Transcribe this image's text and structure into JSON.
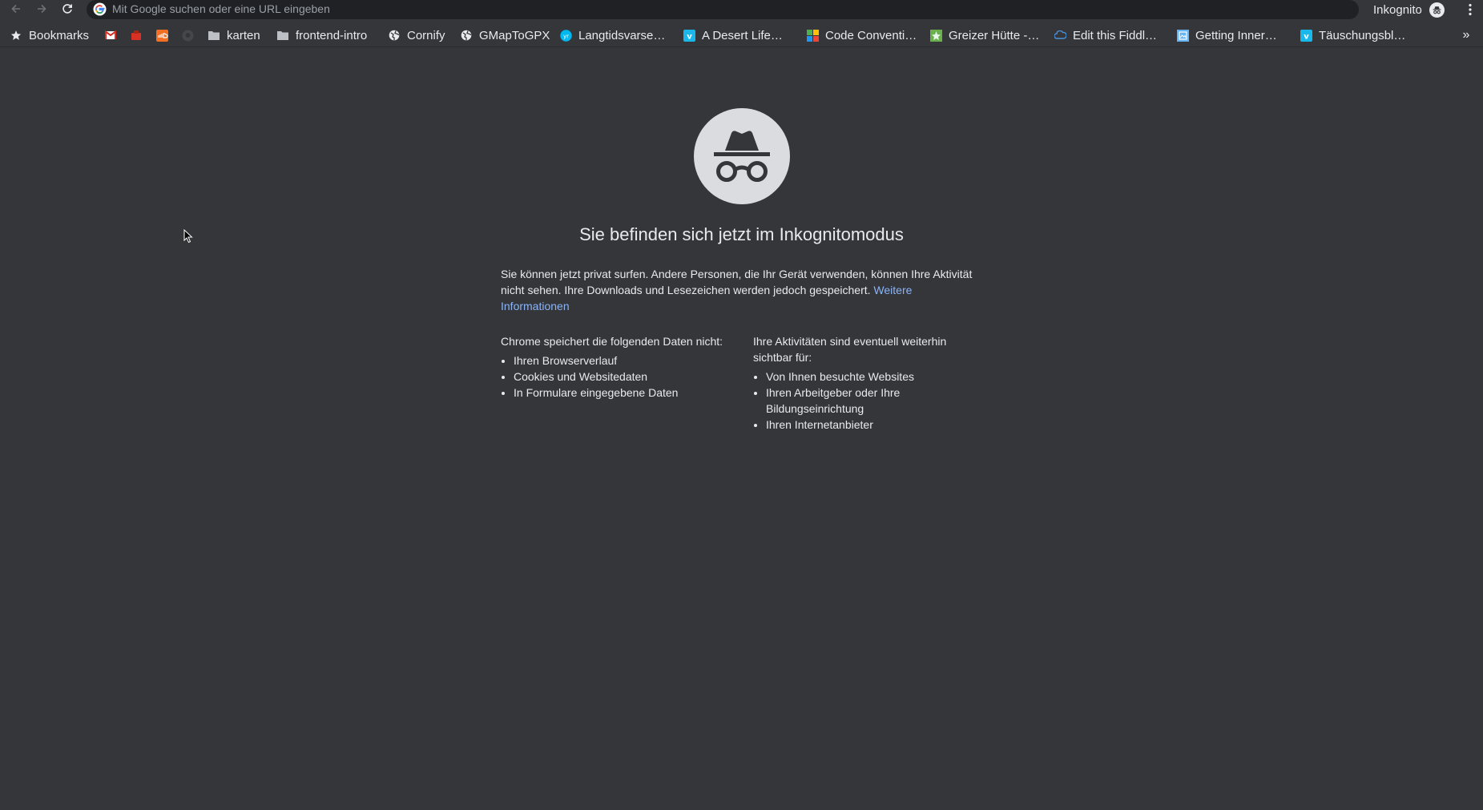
{
  "toolbar": {
    "omnibox_placeholder": "Mit Google suchen oder eine URL eingeben",
    "profile_label": "Inkognito"
  },
  "bookmarks": [
    {
      "label": "Bookmarks",
      "icon": "star-icon"
    },
    {
      "label": "",
      "icon": "gmail-icon"
    },
    {
      "label": "",
      "icon": "red-app-icon"
    },
    {
      "label": "",
      "icon": "soundcloud-icon"
    },
    {
      "label": "",
      "icon": "github-icon"
    },
    {
      "label": "karten",
      "icon": "folder-icon"
    },
    {
      "label": "frontend-intro",
      "icon": "folder-icon"
    },
    {
      "label": "Cornify",
      "icon": "globe-icon"
    },
    {
      "label": "GMapToGPX",
      "icon": "globe-icon"
    },
    {
      "label": "Langtidsvarse…",
      "icon": "yr-icon"
    },
    {
      "label": "A Desert Life…",
      "icon": "vimeo-icon"
    },
    {
      "label": "Code Conventi…",
      "icon": "code-icon"
    },
    {
      "label": "Greizer Hütte -…",
      "icon": "leaf-icon"
    },
    {
      "label": "Edit this Fiddl…",
      "icon": "fiddle-icon"
    },
    {
      "label": "Getting Inner…",
      "icon": "photo-icon"
    },
    {
      "label": "Täuschungsbl…",
      "icon": "vimeo-icon"
    }
  ],
  "main": {
    "heading": "Sie befinden sich jetzt im Inkognitomodus",
    "intro_text": "Sie können jetzt privat surfen. Andere Personen, die Ihr Gerät verwenden, können Ihre Aktivität nicht sehen. Ihre Downloads und Lesezeichen werden jedoch gespeichert.",
    "learn_more": "Weitere Informationen",
    "left_column": {
      "title": "Chrome speichert die folgenden Daten nicht:",
      "items": [
        "Ihren Browserverlauf",
        "Cookies und Websitedaten",
        "In Formulare eingegebene Daten"
      ]
    },
    "right_column": {
      "title": "Ihre Aktivitäten sind eventuell weiterhin sichtbar für:",
      "items": [
        "Von Ihnen besuchte Websites",
        "Ihren Arbeitgeber oder Ihre Bildungseinrichtung",
        "Ihren Internetanbieter"
      ]
    }
  },
  "colors": {
    "background": "#35363a",
    "omnibox": "#202124",
    "link": "#8ab4f8",
    "text": "#e8eaed"
  }
}
